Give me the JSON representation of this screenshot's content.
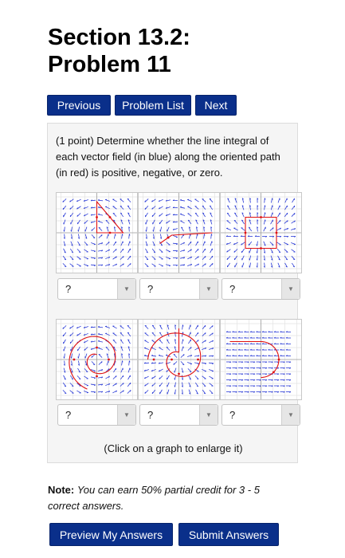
{
  "page": {
    "title_line1": "Section 13.2:",
    "title_line2": "Problem 11"
  },
  "nav": {
    "previous_label": "Previous",
    "problem_list_label": "Problem List",
    "next_label": "Next"
  },
  "problem": {
    "text": "(1 point) Determine whether the line integral of each vector field (in blue) along the oriented path (in red) is positive, negative, or zero.",
    "enlarge_hint": "(Click on a graph to enlarge it)",
    "graphs": [
      {
        "select_value": "?"
      },
      {
        "select_value": "?"
      },
      {
        "select_value": "?"
      },
      {
        "select_value": "?"
      },
      {
        "select_value": "?"
      },
      {
        "select_value": "?"
      }
    ]
  },
  "note": {
    "label": "Note:",
    "text": "You can earn 50% partial credit for 3 - 5 correct answers."
  },
  "actions": {
    "preview_label": "Preview My Answers",
    "submit_label": "Submit Answers"
  },
  "colors": {
    "button_bg": "#0a2f8a",
    "field_arrows": "#2a3bd6",
    "path": "#e01010"
  }
}
